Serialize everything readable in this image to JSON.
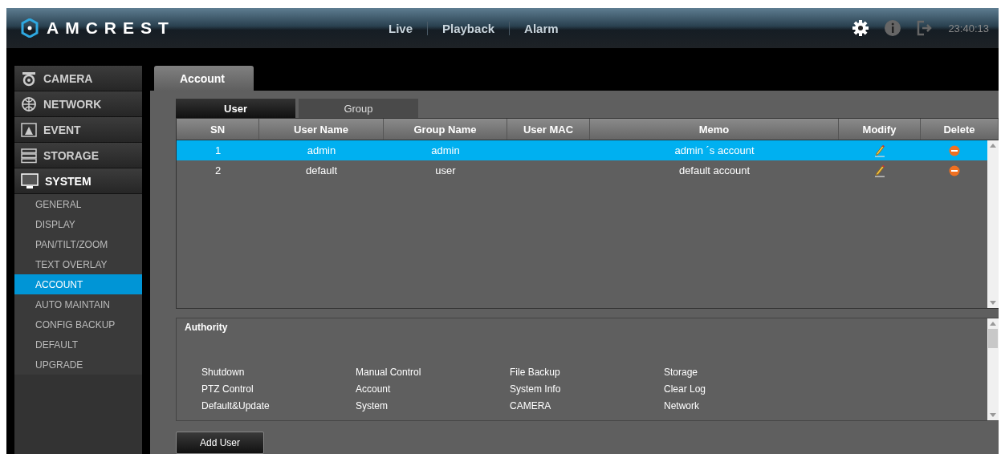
{
  "header": {
    "brand": "AMCREST",
    "nav": [
      {
        "label": "Live",
        "selected": false
      },
      {
        "label": "Playback",
        "selected": false
      },
      {
        "label": "Alarm",
        "selected": false
      }
    ],
    "time": "23:40:13"
  },
  "sidebar": {
    "items": [
      {
        "label": "CAMERA",
        "kind": "camera",
        "expanded": false
      },
      {
        "label": "NETWORK",
        "kind": "network",
        "expanded": false
      },
      {
        "label": "EVENT",
        "kind": "event",
        "expanded": false
      },
      {
        "label": "STORAGE",
        "kind": "storage",
        "expanded": false
      },
      {
        "label": "SYSTEM",
        "kind": "system",
        "expanded": true,
        "children": [
          {
            "label": "GENERAL",
            "selected": false
          },
          {
            "label": "DISPLAY",
            "selected": false
          },
          {
            "label": "PAN/TILT/ZOOM",
            "selected": false
          },
          {
            "label": "TEXT OVERLAY",
            "selected": false
          },
          {
            "label": "ACCOUNT",
            "selected": true
          },
          {
            "label": "AUTO MAINTAIN",
            "selected": false
          },
          {
            "label": "CONFIG BACKUP",
            "selected": false
          },
          {
            "label": "DEFAULT",
            "selected": false
          },
          {
            "label": "UPGRADE",
            "selected": false
          }
        ]
      }
    ]
  },
  "page_tab": "Account",
  "subtabs": [
    {
      "label": "User",
      "selected": true
    },
    {
      "label": "Group",
      "selected": false
    }
  ],
  "table": {
    "columns": [
      "SN",
      "User Name",
      "Group Name",
      "User MAC",
      "Memo",
      "Modify",
      "Delete"
    ],
    "rows": [
      {
        "cells": [
          "1",
          "admin",
          "admin",
          "",
          "admin ´s account"
        ],
        "selected": true
      },
      {
        "cells": [
          "2",
          "default",
          "user",
          "",
          "default account"
        ],
        "selected": false
      }
    ]
  },
  "authority": {
    "title": "Authority",
    "items": [
      "Shutdown",
      "Manual Control",
      "File Backup",
      "Storage",
      "PTZ Control",
      "Account",
      "System Info",
      "Clear Log",
      "Default&Update",
      "System",
      "CAMERA",
      "Network"
    ]
  },
  "add_button": "Add User"
}
